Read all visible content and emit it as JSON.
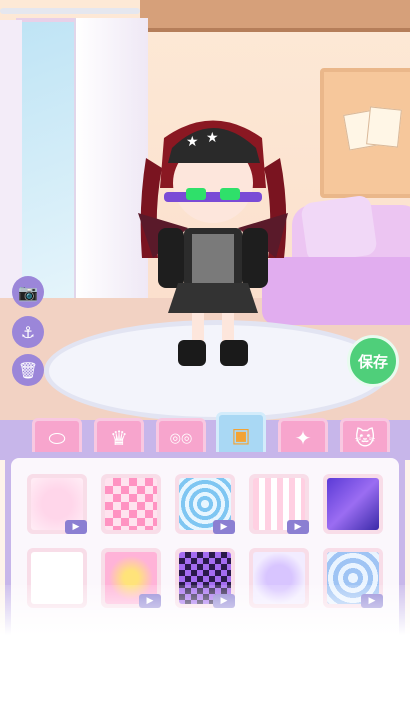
{
  "save_button": {
    "label": "保存"
  },
  "side_tools": [
    {
      "icon": "camera-icon",
      "glyph": "📷"
    },
    {
      "icon": "anchor-icon",
      "glyph": "⚓"
    },
    {
      "icon": "trash-icon",
      "glyph": "🗑"
    }
  ],
  "tabs": [
    {
      "icon": "shoes-icon",
      "glyph": "⬭",
      "active": false
    },
    {
      "icon": "crown-icon",
      "glyph": "♛",
      "active": false
    },
    {
      "icon": "glasses-icon",
      "glyph": "◎◎",
      "active": false
    },
    {
      "icon": "background-image-icon",
      "glyph": "▣",
      "active": true
    },
    {
      "icon": "magic-wand-icon",
      "glyph": "✦",
      "active": false
    },
    {
      "icon": "cat-icon",
      "glyph": "🐱",
      "active": false
    }
  ],
  "backgrounds": [
    {
      "name": "bg-pink-bow",
      "video": true
    },
    {
      "name": "bg-pink-checker",
      "video": false
    },
    {
      "name": "bg-blue-heart",
      "video": true
    },
    {
      "name": "bg-pink-hearts",
      "video": true
    },
    {
      "name": "bg-purple-galaxy",
      "video": false
    },
    {
      "name": "bg-white-grid",
      "video": false
    },
    {
      "name": "bg-pink-stars",
      "video": true
    },
    {
      "name": "bg-purple-checker",
      "video": true
    },
    {
      "name": "bg-lilac-heart",
      "video": false
    },
    {
      "name": "bg-blue-star",
      "video": true
    }
  ],
  "colors": {
    "save": "#4fcf7a",
    "tab": "#f7a5cd",
    "tab_active": "#a9d8f4",
    "panel": "#c7b6ea",
    "tool": "#9b86d9"
  }
}
